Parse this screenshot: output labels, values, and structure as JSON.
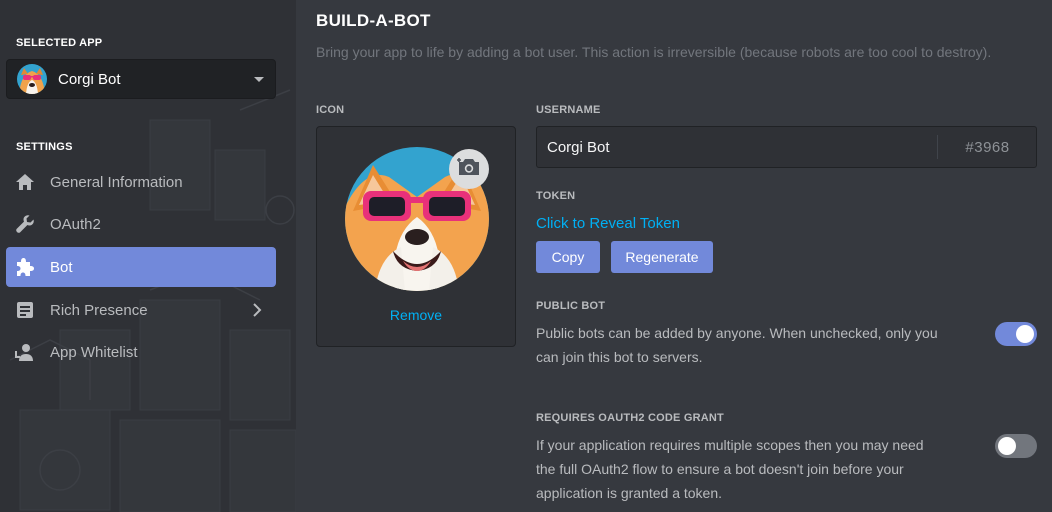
{
  "sidebar": {
    "selected_app_label": "SELECTED APP",
    "app_name": "Corgi Bot",
    "settings_label": "SETTINGS",
    "items": [
      {
        "label": "General Information",
        "icon": "home-icon"
      },
      {
        "label": "OAuth2",
        "icon": "wrench-icon"
      },
      {
        "label": "Bot",
        "icon": "puzzle-icon"
      },
      {
        "label": "Rich Presence",
        "icon": "document-icon"
      },
      {
        "label": "App Whitelist",
        "icon": "user-icon"
      }
    ]
  },
  "main": {
    "title": "BUILD-A-BOT",
    "description": "Bring your app to life by adding a bot user. This action is irreversible (because robots are too cool to destroy).",
    "icon_label": "ICON",
    "remove_label": "Remove",
    "username_label": "USERNAME",
    "username_value": "Corgi Bot",
    "discriminator": "#3968",
    "token_label": "TOKEN",
    "reveal_token": "Click to Reveal Token",
    "copy_label": "Copy",
    "regenerate_label": "Regenerate",
    "public_bot_label": "PUBLIC BOT",
    "public_bot_desc_1": "Public bots can be added by anyone. When unchecked, only you",
    "public_bot_desc_2": "can join this bot to servers.",
    "public_bot_enabled": true,
    "oauth_grant_label": "REQUIRES OAUTH2 CODE GRANT",
    "oauth_grant_desc_1": "If your application requires multiple scopes then you may need",
    "oauth_grant_desc_2": "the full OAuth2 flow to ensure a bot doesn't join before your",
    "oauth_grant_desc_3": "application is granted a token.",
    "oauth_grant_enabled": false
  },
  "colors": {
    "accent": "#7289da",
    "link": "#00b0f4",
    "toggle_off": "#72767d",
    "background": "#36393f",
    "sidebar": "#2f3136"
  }
}
